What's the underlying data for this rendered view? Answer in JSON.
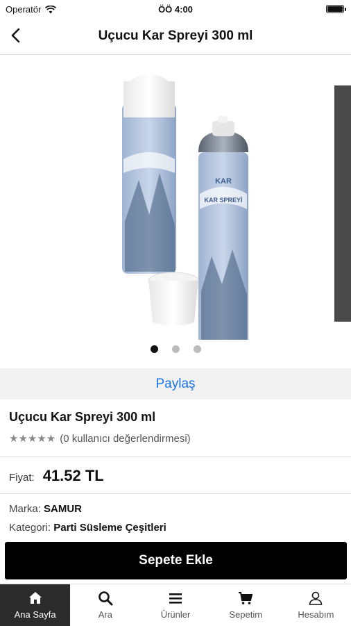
{
  "status": {
    "carrier": "Operatör",
    "time": "ÖÖ 4:00"
  },
  "nav": {
    "title": "Uçucu Kar Spreyi 300 ml"
  },
  "gallery": {
    "page_index": 0,
    "page_count": 3,
    "can_text": [
      "KAR",
      "KAR SPREYİ"
    ]
  },
  "share_label": "Paylaş",
  "product": {
    "name": "Uçucu Kar Spreyi 300 ml",
    "stars": "★★★★★",
    "rating_text": "(0 kullanıcı değerlendirmesi)",
    "price_label": "Fiyat:",
    "price": "41.52 TL",
    "brand_label": "Marka:",
    "brand": "SAMUR",
    "category_label": "Kategori:",
    "category": "Parti Süsleme Çeşitleri"
  },
  "cart_button": "Sepete Ekle",
  "tabs": [
    {
      "label": "Ana Sayfa",
      "icon": "home-icon",
      "active": true
    },
    {
      "label": "Ara",
      "icon": "search-icon",
      "active": false
    },
    {
      "label": "Ürünler",
      "icon": "menu-icon",
      "active": false
    },
    {
      "label": "Sepetim",
      "icon": "cart-icon",
      "active": false
    },
    {
      "label": "Hesabım",
      "icon": "user-icon",
      "active": false
    }
  ]
}
